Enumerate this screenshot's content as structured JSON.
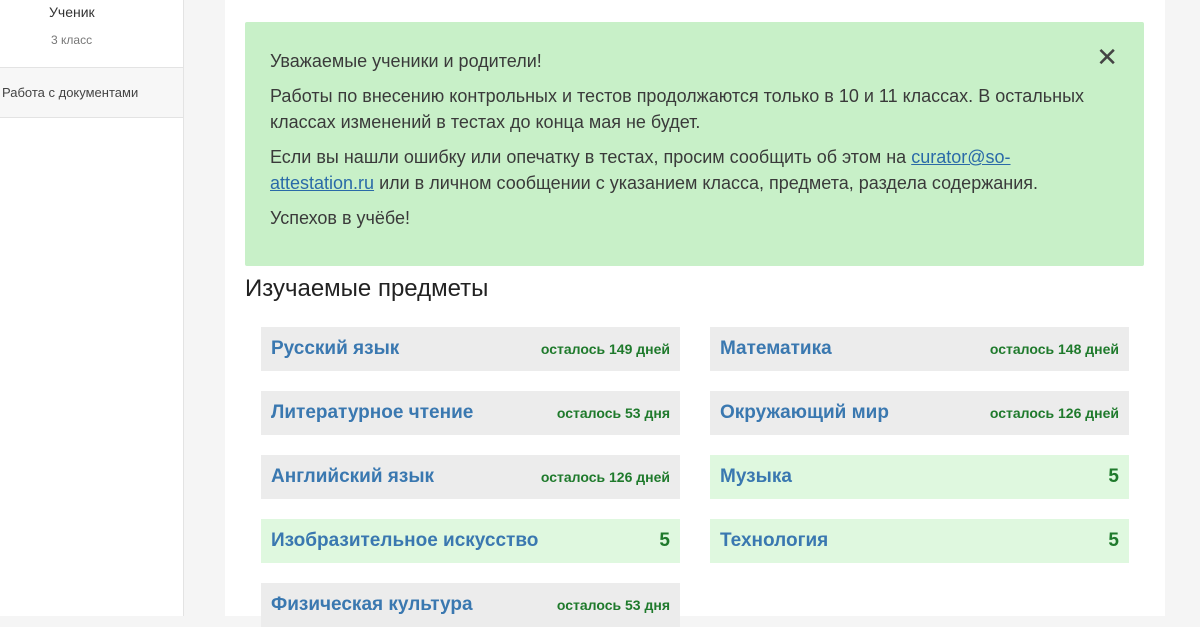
{
  "sidebar": {
    "user_name": "Ученик",
    "user_class": "3 класс",
    "nav_documents": "Работа с документами"
  },
  "alert": {
    "greeting": "Уважаемые ученики и родители!",
    "paragraph1": "Работы по внесению контрольных и тестов продолжаются только в 10 и 11 классах. В остальных классах изменений в тестах до конца мая не будет.",
    "paragraph2_start": "Если вы нашли ошибку или опечатку в тестах, просим сообщить об этом на ",
    "email_link": "curator@so-attestation.ru",
    "paragraph2_end": " или в личном сообщении с указанием класса, предмета, раздела содержания.",
    "closing": "Успехов в учёбе!",
    "close_symbol": "✕"
  },
  "section_title": "Изучаемые предметы",
  "subjects": [
    {
      "name": "Русский язык",
      "status": "осталось 149 дней",
      "done": false
    },
    {
      "name": "Математика",
      "status": "осталось 148 дней",
      "done": false
    },
    {
      "name": "Литературное чтение",
      "status": "осталось 53 дня",
      "done": false
    },
    {
      "name": "Окружающий мир",
      "status": "осталось 126 дней",
      "done": false
    },
    {
      "name": "Английский язык",
      "status": "осталось 126 дней",
      "done": false
    },
    {
      "name": "Музыка",
      "status": "5",
      "done": true
    },
    {
      "name": "Изобразительное искусство",
      "status": "5",
      "done": true
    },
    {
      "name": "Технология",
      "status": "5",
      "done": true
    },
    {
      "name": "Физическая культура",
      "status": "осталось 53 дня",
      "done": false
    }
  ],
  "colors": {
    "alert_bg": "#c8f0c8",
    "subject_link": "#3a78b0",
    "status_green": "#1f7a2c",
    "done_bg": "#dff8df",
    "pending_bg": "#ececec"
  }
}
